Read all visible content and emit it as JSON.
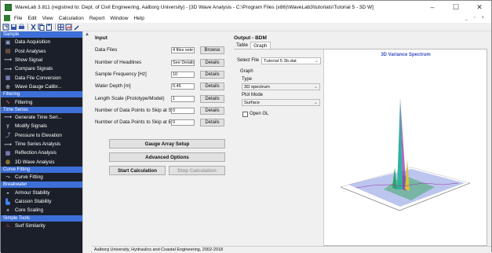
{
  "window": {
    "title": "WaveLab 3.811 (registred to: Dept. of Civil Engineering, Aalborg University) - [3D Wave Analysis - C:\\Program Files (x86)\\WaveLab3\\tutorials\\Tutorial 5 - 3D W]",
    "minimize": "–",
    "maximize": "☐",
    "close": "✕"
  },
  "menu": {
    "items": [
      "File",
      "Edit",
      "View",
      "Calculation",
      "Report",
      "Window",
      "Help"
    ],
    "right_controls": "_ ▫ ×"
  },
  "toolbar": {
    "icons": [
      "toggle-icon",
      "save-icon",
      "print-icon",
      "cut-icon",
      "copy-icon",
      "paste-icon",
      "grid-icon",
      "chart-icon",
      "edit-icon"
    ]
  },
  "sidebar": {
    "groups": [
      {
        "label": "Sample",
        "items": [
          {
            "label": "Data Acquisition",
            "icon": "acquisition-icon",
            "color": "#9ad"
          },
          {
            "label": "Post Analyses",
            "icon": "chart-icon",
            "color": "#c86"
          },
          {
            "label": "Show Signal",
            "icon": "signal-icon",
            "color": "#dde"
          },
          {
            "label": "Compare Signals",
            "icon": "compare-icon",
            "color": "#dde"
          },
          {
            "label": "Data File Conversion",
            "icon": "file-icon",
            "color": "#aaf"
          },
          {
            "label": "Wave Gauge Calibr...",
            "icon": "gauge-icon",
            "color": "#ddd"
          }
        ]
      },
      {
        "label": "Filtering",
        "items": [
          {
            "label": "Filtering",
            "icon": "filter-icon",
            "color": "#f66"
          }
        ]
      },
      {
        "label": "Time Series",
        "items": [
          {
            "label": "Generate Time Seri...",
            "icon": "generate-icon",
            "color": "#dde"
          },
          {
            "label": "Modify Signals",
            "icon": "modify-icon",
            "color": "#ddd"
          },
          {
            "label": "Pressure to Elevation",
            "icon": "pressure-icon",
            "color": "#aad"
          },
          {
            "label": "Time Series Analysis",
            "icon": "timeseries-icon",
            "color": "#dde"
          },
          {
            "label": "Reflection Analysis",
            "icon": "reflection-icon",
            "color": "#aaf"
          },
          {
            "label": "3D Wave Analysis",
            "icon": "wave3d-icon",
            "color": "#fc4"
          }
        ]
      },
      {
        "label": "Curve Fitting",
        "items": [
          {
            "label": "Curve Fitting",
            "icon": "curve-icon",
            "color": "#ddd"
          }
        ]
      },
      {
        "label": "Breakwater",
        "items": [
          {
            "label": "Armour Stability",
            "icon": "armour-icon",
            "color": "#ccc"
          },
          {
            "label": "Caisson Stability",
            "icon": "caisson-icon",
            "color": "#48f"
          },
          {
            "label": "Core Scaling",
            "icon": "core-icon",
            "color": "#aaa"
          }
        ]
      },
      {
        "label": "Simple Tools",
        "items": [
          {
            "label": "Surf Similarity",
            "icon": "surf-icon",
            "color": "#f66"
          }
        ]
      }
    ]
  },
  "input": {
    "title": "Input",
    "rows": [
      {
        "label": "Data Files",
        "value": "4 files sele",
        "button": "Browse"
      },
      {
        "label": "Number of Headlines",
        "value": "See Details",
        "button": "Details"
      },
      {
        "label": "Sample Frequency [Hz]",
        "value": "10",
        "button": "Details"
      },
      {
        "label": "Water Depth [m]",
        "value": "0.45",
        "button": "Details"
      },
      {
        "label": "Length Scale (Prototype/Model)",
        "value": "1",
        "button": "Details"
      },
      {
        "label": "Number of Data Points to Skip at Start",
        "value": "0",
        "button": "Details"
      },
      {
        "label": "Number of Data Points to Skip at End",
        "value": "0",
        "button": "Details"
      }
    ],
    "gauge_button": "Gauge Array Setup",
    "advanced_button": "Advanced Options",
    "start_button": "Start Calculation",
    "stop_button": "Stop Calculation"
  },
  "output": {
    "title": "Output - BDM",
    "tabs": [
      "Table",
      "Graph"
    ],
    "active_tab": "Graph",
    "select_file_label": "Select File",
    "select_file_value": "Tutorial 5 3b.dat",
    "graph_group": "Graph",
    "type_label": "Type",
    "type_value": "3D spectrum",
    "plot_mode_label": "Plot Mode",
    "plot_mode_value": "Surface",
    "opengl_label": "Open GL",
    "plot_title": "3D Variance Spectrum"
  },
  "status": {
    "text": "Aalborg University, Hydraulics and Coastal Engineering, 2002-2018"
  }
}
